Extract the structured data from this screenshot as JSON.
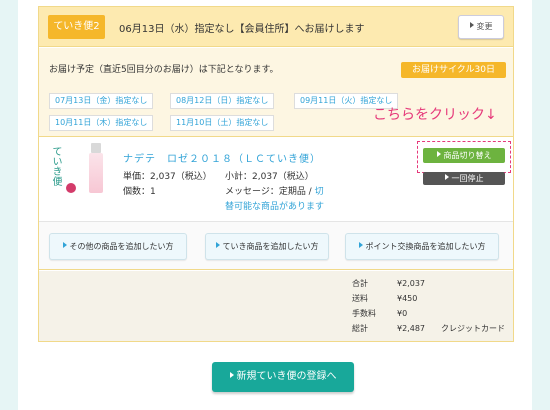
{
  "header": {
    "tag": "ていき便2",
    "text": "06月13日（水）指定なし【会員住所】へお届けします",
    "change_button": "変更"
  },
  "schedule": {
    "title": "お届け予定（直近5回目分のお届け）は下記となります。",
    "cycle": "お届けサイクル30日",
    "dates": [
      "07月13日（金）指定なし",
      "08月12日（日）指定なし",
      "09月11日（火）指定なし",
      "10月11日（木）指定なし",
      "11月10日（土）指定なし"
    ]
  },
  "annotation": "こちらをクリック↓",
  "product": {
    "logo": "ていき便",
    "name": "ナデテ　ロゼ２０１８（ＬＣていき便）",
    "unit_price": "単価：2,037（税込）",
    "quantity": "個数：1",
    "subtotal": "小計：2,037（税込）",
    "message_prefix": "メッセージ：定期品 / ",
    "message_link_1": "切",
    "message_link_2": "替可能な商品があります",
    "switch_button": "商品切り替え",
    "pause_button": "一回停止"
  },
  "add_buttons": [
    "その他の商品を追加したい方",
    "ていき商品を追加したい方",
    "ポイント交換商品を追加したい方"
  ],
  "totals": [
    {
      "label": "合計",
      "value": "¥2,037",
      "extra": ""
    },
    {
      "label": "送料",
      "value": "¥450",
      "extra": ""
    },
    {
      "label": "手数料",
      "value": "¥0",
      "extra": ""
    },
    {
      "label": "総計",
      "value": "¥2,487",
      "extra": "クレジットカード"
    }
  ],
  "register_button": "新規ていき便の登録へ",
  "colors": {
    "accent_orange": "#f5b72a",
    "link_blue": "#31a3d7",
    "highlight_pink": "#e6397a",
    "switch_green": "#6db33f",
    "register_teal": "#18a89a"
  }
}
